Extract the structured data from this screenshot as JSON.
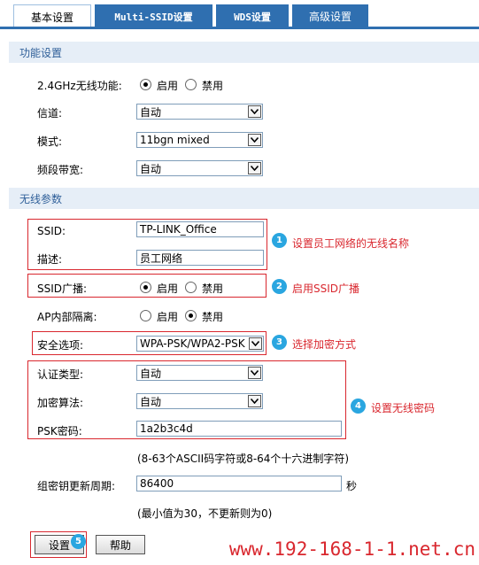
{
  "tabs": [
    {
      "label": "基本设置"
    },
    {
      "label": "Multi-SSID设置"
    },
    {
      "label": "WDS设置"
    },
    {
      "label": "高级设置"
    }
  ],
  "function_section": {
    "title": "功能设置",
    "wireless_label": "2.4GHz无线功能:",
    "enable_label": "启用",
    "disable_label": "禁用",
    "channel_label": "信道:",
    "channel_value": "自动",
    "mode_label": "模式:",
    "mode_value": "11bgn mixed",
    "bandwidth_label": "频段带宽:",
    "bandwidth_value": "自动"
  },
  "wireless_section": {
    "title": "无线参数",
    "ssid_label": "SSID:",
    "ssid_value": "TP-LINK_Office",
    "desc_label": "描述:",
    "desc_value": "员工网络",
    "broadcast_label": "SSID广播:",
    "isolation_label": "AP内部隔离:",
    "enable_label": "启用",
    "disable_label": "禁用",
    "security_label": "安全选项:",
    "security_value": "WPA-PSK/WPA2-PSK",
    "auth_label": "认证类型:",
    "auth_value": "自动",
    "cipher_label": "加密算法:",
    "cipher_value": "自动",
    "psk_label": "PSK密码:",
    "psk_value": "1a2b3c4d",
    "psk_hint": "(8-63个ASCII码字符或8-64个十六进制字符)",
    "rekey_label": "组密钥更新周期:",
    "rekey_value": "86400",
    "rekey_unit": "秒",
    "rekey_hint": "(最小值为30，不更新则为0)"
  },
  "annotations": [
    {
      "num": "1",
      "text": "设置员工网络的无线名称"
    },
    {
      "num": "2",
      "text": "启用SSID广播"
    },
    {
      "num": "3",
      "text": "选择加密方式"
    },
    {
      "num": "4",
      "text": "设置无线密码"
    },
    {
      "num": "5",
      "text": ""
    }
  ],
  "buttons": {
    "save": "设置",
    "help": "帮助"
  },
  "watermark": "www.192-168-1-1.net.cn",
  "colors": {
    "tab_blue": "#2f6fb0",
    "section_bg": "#e6eef7",
    "section_text": "#2f5f99",
    "annotation_red": "#d9272e",
    "badge_blue": "#2aa6e0"
  }
}
